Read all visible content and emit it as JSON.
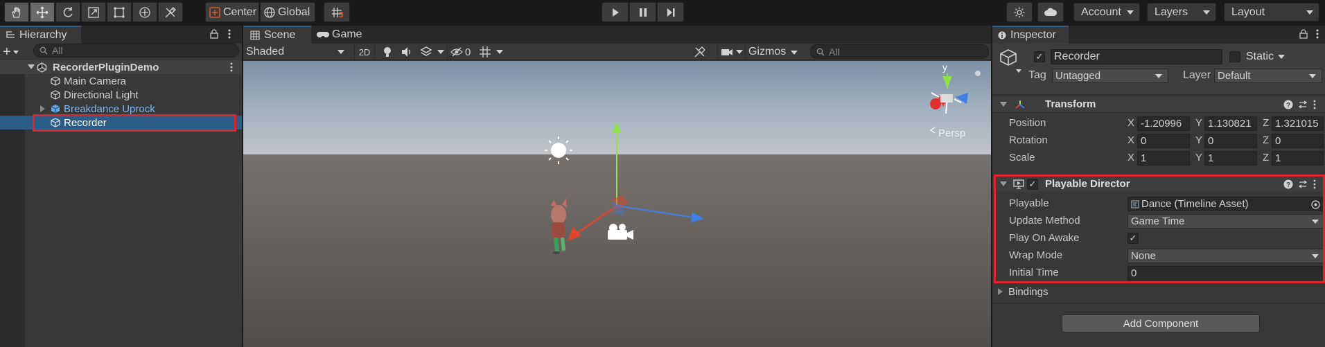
{
  "toolbar": {
    "center_label": "Center",
    "global_label": "Global",
    "account_label": "Account",
    "layers_label": "Layers",
    "layout_label": "Layout"
  },
  "hierarchy": {
    "tab_label": "Hierarchy",
    "search_placeholder": "All",
    "scene_name": "RecorderPluginDemo",
    "items": [
      {
        "label": "Main Camera"
      },
      {
        "label": "Directional Light"
      },
      {
        "label": "Breakdance Uprock"
      },
      {
        "label": "Recorder"
      }
    ]
  },
  "scene": {
    "tab_scene": "Scene",
    "tab_game": "Game",
    "shading_mode": "Shaded",
    "mode_2d": "2D",
    "hidden_count": "0",
    "gizmos_label": "Gizmos",
    "search_placeholder": "All",
    "gizmo_y": "y",
    "persp_label": "Persp"
  },
  "inspector": {
    "tab_label": "Inspector",
    "object_name": "Recorder",
    "static_label": "Static",
    "tag_label": "Tag",
    "tag_value": "Untagged",
    "layer_label": "Layer",
    "layer_value": "Default",
    "transform": {
      "title": "Transform",
      "position_label": "Position",
      "rotation_label": "Rotation",
      "scale_label": "Scale",
      "position": {
        "x": "-1.20996",
        "y": "1.130821",
        "z": "1.321015"
      },
      "rotation": {
        "x": "0",
        "y": "0",
        "z": "0"
      },
      "scale": {
        "x": "1",
        "y": "1",
        "z": "1"
      },
      "axis_x": "X",
      "axis_y": "Y",
      "axis_z": "Z"
    },
    "director": {
      "title": "Playable Director",
      "playable_label": "Playable",
      "playable_value": "Dance (Timeline Asset)",
      "update_method_label": "Update Method",
      "update_method_value": "Game Time",
      "play_on_awake_label": "Play On Awake",
      "wrap_mode_label": "Wrap Mode",
      "wrap_mode_value": "None",
      "initial_time_label": "Initial Time",
      "initial_time_value": "0"
    },
    "bindings_label": "Bindings",
    "add_component_label": "Add Component"
  },
  "colors": {
    "highlight": "#e0242b",
    "selection": "#2c5d87",
    "prefab_blue": "#7ab9f5"
  }
}
